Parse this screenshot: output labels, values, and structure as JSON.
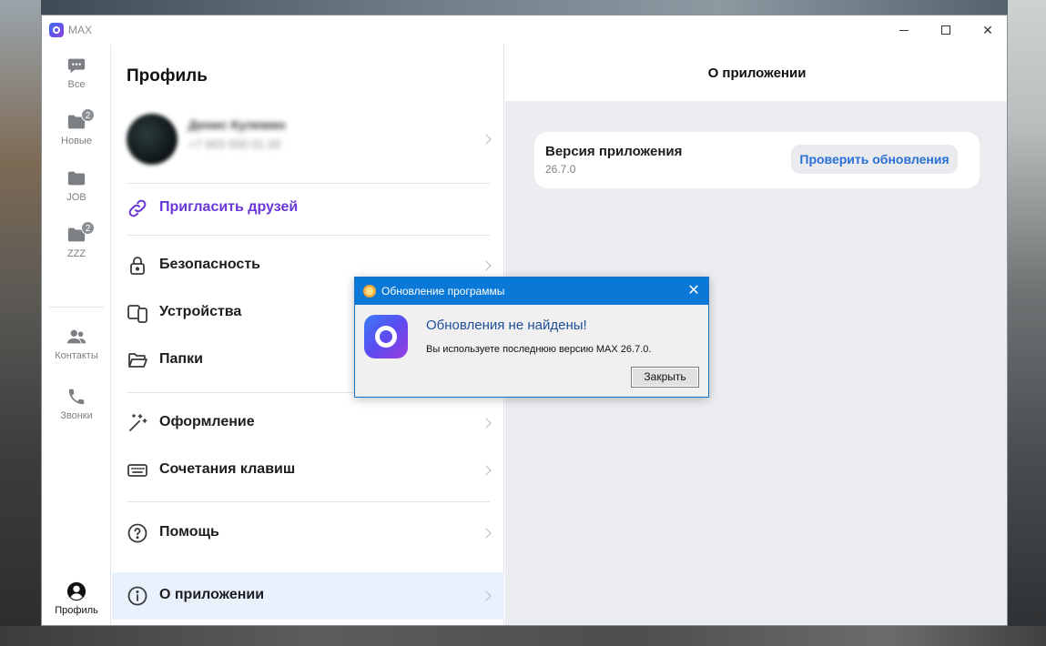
{
  "window": {
    "app_title": "MAX",
    "controls": {
      "minimize": "minimize",
      "maximize": "maximize",
      "close": "✕"
    }
  },
  "rail": {
    "items": [
      {
        "label": "Все",
        "icon": "chat-icon",
        "badge": ""
      },
      {
        "label": "Новые",
        "icon": "folder-icon",
        "badge": "2"
      },
      {
        "label": "JOB",
        "icon": "folder-icon",
        "badge": ""
      },
      {
        "label": "ZZZ",
        "icon": "folder-icon",
        "badge": "2"
      },
      {
        "label": "Контакты",
        "icon": "contacts-icon",
        "badge": ""
      },
      {
        "label": "Звонки",
        "icon": "phone-icon",
        "badge": ""
      },
      {
        "label": "Профиль",
        "icon": "profile-icon",
        "badge": ""
      }
    ]
  },
  "profile": {
    "title": "Профиль",
    "name": "Денис Кулемин",
    "phone": "+7 903 000 01 00"
  },
  "menu": {
    "invite": "Пригласить друзей",
    "security": "Безопасность",
    "devices": "Устройства",
    "folders": "Папки",
    "appearance": "Оформление",
    "shortcuts": "Сочетания клавиш",
    "help": "Помощь",
    "about": "О приложении"
  },
  "content": {
    "title": "О приложении",
    "version_label": "Версия приложения",
    "version": "26.7.0",
    "check_button": "Проверить обновления"
  },
  "dialog": {
    "title": "Обновление программы",
    "heading": "Обновления не найдены!",
    "message": "Вы используете последнюю версию MAX 26.7.0.",
    "close_button": "Закрыть",
    "close_glyph": "✕"
  },
  "colors": {
    "accent_blue": "#2a6fd6",
    "invite_purple": "#6a37d9",
    "dialog_titlebar": "#0a78d7",
    "active_row": "#e9f1fc"
  }
}
